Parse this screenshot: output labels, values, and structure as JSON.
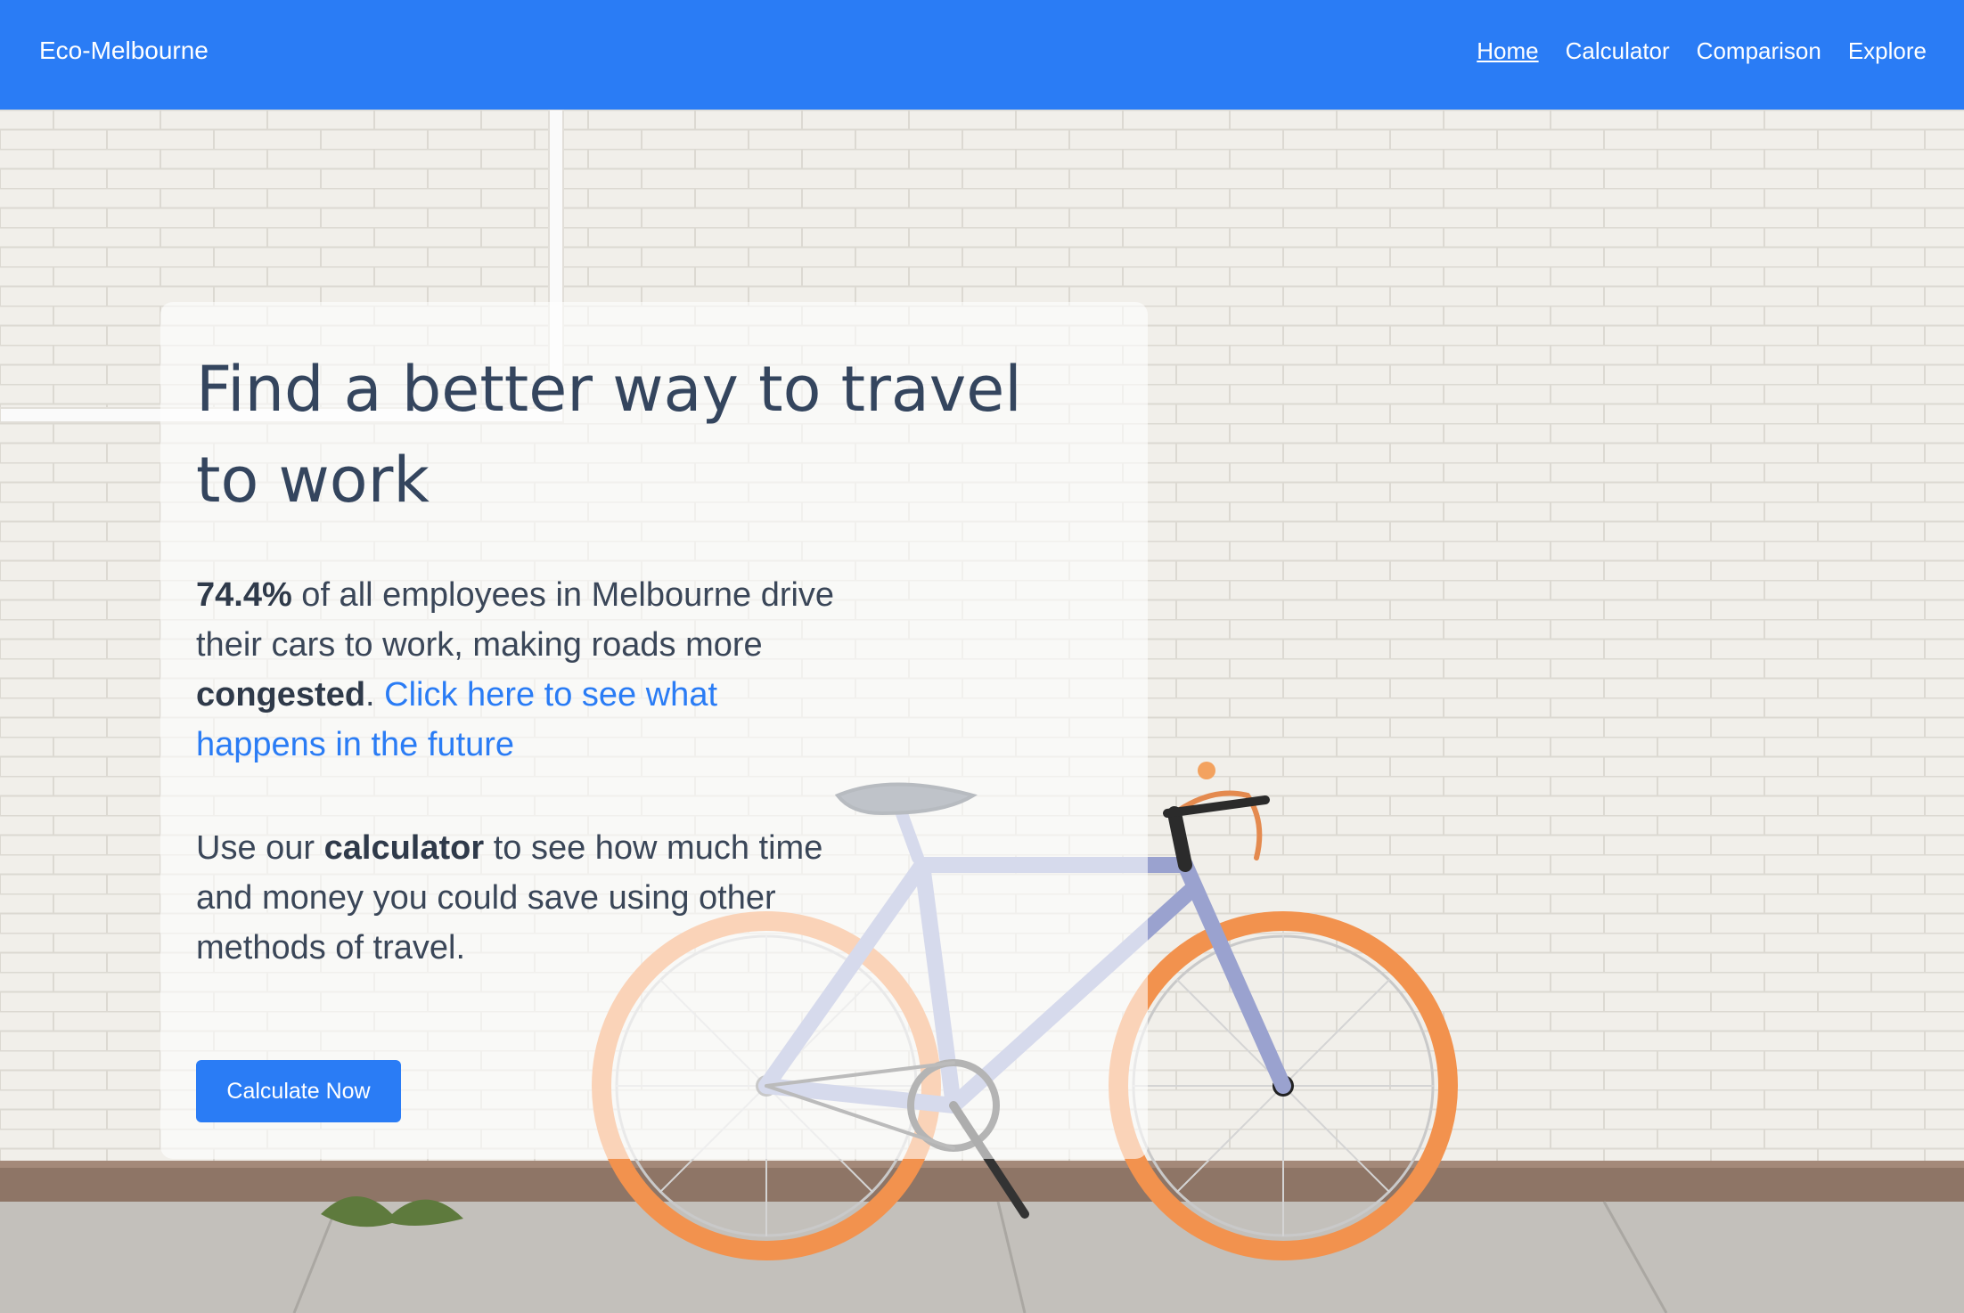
{
  "nav": {
    "brand": "Eco-Melbourne",
    "links": [
      {
        "label": "Home",
        "active": true
      },
      {
        "label": "Calculator",
        "active": false
      },
      {
        "label": "Comparison",
        "active": false
      },
      {
        "label": "Explore",
        "active": false
      }
    ]
  },
  "hero": {
    "headline": "Find a better way to travel to work",
    "stat": {
      "percent": "74.4%",
      "text_a": " of all employees in Melbourne drive their cars to work, making roads more ",
      "emphasis": "congested",
      "period": ". ",
      "link_text": "Click here to see what happens in the future"
    },
    "calc": {
      "prefix": "Use our ",
      "emphasis": "calculator",
      "suffix": " to see how much time and money you could save using other methods of travel."
    },
    "cta_label": "Calculate Now"
  },
  "colors": {
    "primary": "#2a7cf5",
    "heading": "#34455e",
    "body_text": "#3a4658"
  }
}
